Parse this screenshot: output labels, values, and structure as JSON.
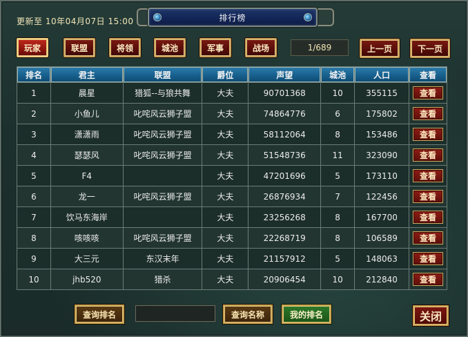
{
  "header": {
    "updated_text": "更新至 10年04月07日 15:00",
    "title": "排行榜"
  },
  "tabs": [
    {
      "label": "玩家",
      "active": true
    },
    {
      "label": "联盟",
      "active": false
    },
    {
      "label": "将领",
      "active": false
    },
    {
      "label": "城池",
      "active": false
    },
    {
      "label": "军事",
      "active": false
    },
    {
      "label": "战场",
      "active": false
    }
  ],
  "pagination": {
    "indicator": "1/689",
    "prev_label": "上一页",
    "next_label": "下一页"
  },
  "table": {
    "columns": [
      "排名",
      "君主",
      "联盟",
      "爵位",
      "声望",
      "城池",
      "人口",
      "查看"
    ],
    "view_label": "查看",
    "rows": [
      {
        "rank": "1",
        "lord": "晨星",
        "alliance": "猎狐--与狼共舞",
        "title": "大夫",
        "prestige": "90701368",
        "cities": "10",
        "population": "355115"
      },
      {
        "rank": "2",
        "lord": "小鱼儿",
        "alliance": "叱咤风云狮子盟",
        "title": "大夫",
        "prestige": "74864776",
        "cities": "6",
        "population": "175802"
      },
      {
        "rank": "3",
        "lord": "潇潇雨",
        "alliance": "叱咤风云狮子盟",
        "title": "大夫",
        "prestige": "58112064",
        "cities": "8",
        "population": "153486"
      },
      {
        "rank": "4",
        "lord": "瑟瑟风",
        "alliance": "叱咤风云狮子盟",
        "title": "大夫",
        "prestige": "51548736",
        "cities": "11",
        "population": "323090"
      },
      {
        "rank": "5",
        "lord": "F4",
        "alliance": "",
        "title": "大夫",
        "prestige": "47201696",
        "cities": "5",
        "population": "173110"
      },
      {
        "rank": "6",
        "lord": "龙一",
        "alliance": "叱咤风云狮子盟",
        "title": "大夫",
        "prestige": "26876934",
        "cities": "7",
        "population": "122456"
      },
      {
        "rank": "7",
        "lord": "饮马东海岸",
        "alliance": "",
        "title": "大夫",
        "prestige": "23256268",
        "cities": "8",
        "population": "167700"
      },
      {
        "rank": "8",
        "lord": "咳咳咳",
        "alliance": "叱咤风云狮子盟",
        "title": "大夫",
        "prestige": "22268719",
        "cities": "8",
        "population": "106589"
      },
      {
        "rank": "9",
        "lord": "大三元",
        "alliance": "东汉末年",
        "title": "大夫",
        "prestige": "21157912",
        "cities": "5",
        "population": "148063"
      },
      {
        "rank": "10",
        "lord": "jhb520",
        "alliance": "猎杀",
        "title": "大夫",
        "prestige": "20906454",
        "cities": "10",
        "population": "212840"
      }
    ]
  },
  "footer": {
    "query_rank_label": "查询排名",
    "search_value": "",
    "query_name_label": "查询名称",
    "my_rank_label": "我的排名",
    "close_label": "关闭"
  }
}
